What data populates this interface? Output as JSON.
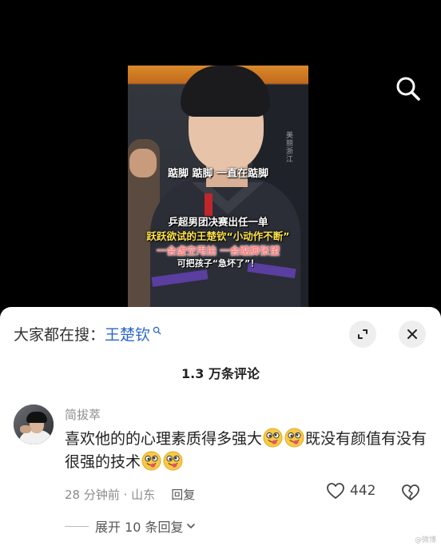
{
  "video": {
    "captions": [
      "踮脚 踮脚 一直在踮脚",
      "乒超男团决赛出任一单",
      "跃跃欲试的王楚钦“小动作不断”",
      "一会虚空甩拍 一会踮脚张望",
      "可把孩子“急坏了”！"
    ],
    "watermark": "美丽浙江"
  },
  "search_icon": "search-icon",
  "sheet": {
    "prefix": "大家都在搜：",
    "query": "王楚钦",
    "comment_count": "1.3 万条评论"
  },
  "comment": {
    "username": "简拔萃",
    "text_part1": "喜欢他的的心理素质得多强大",
    "text_part2": "既没有颜值有没有很强的技术",
    "time": "28 分钟前",
    "location": "山东",
    "reply_label": "回复",
    "likes": "442",
    "expand_replies": "展开 10 条回复"
  },
  "watermark": "@微博"
}
